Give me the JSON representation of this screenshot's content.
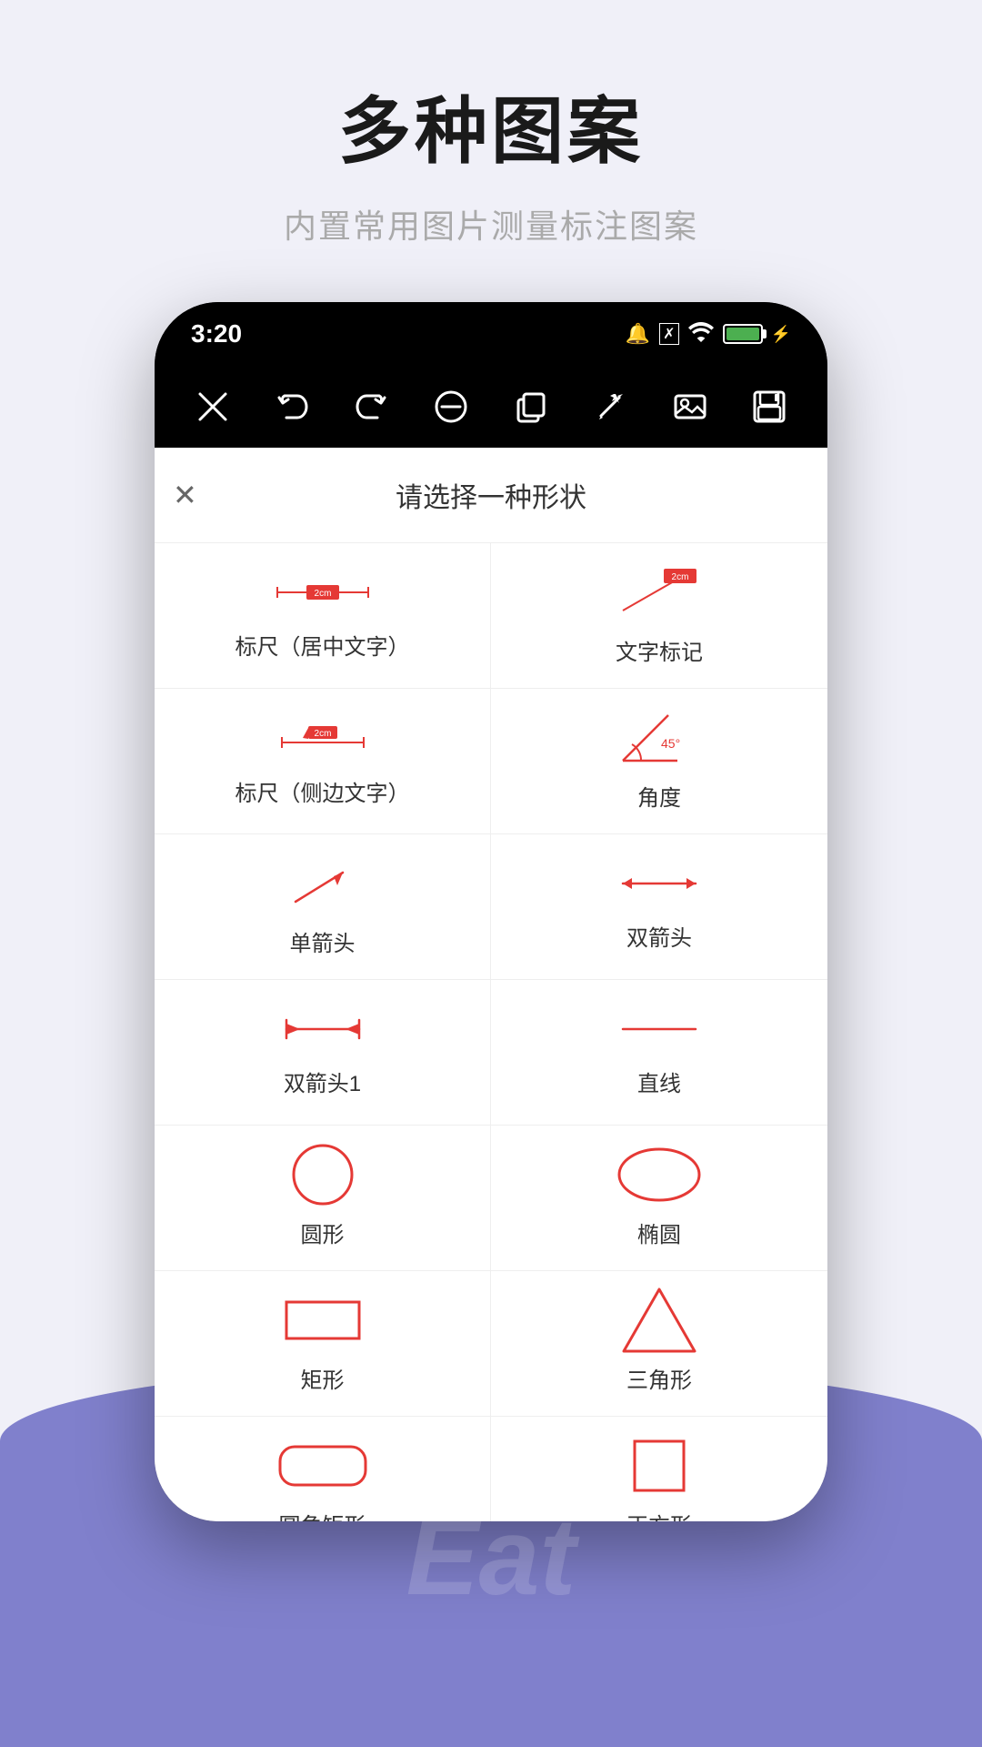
{
  "page": {
    "title": "多种图案",
    "subtitle": "内置常用图片测量标注图案",
    "background_color": "#f0f0f8",
    "accent_color": "#8080cc"
  },
  "status_bar": {
    "time": "3:20",
    "battery_percent": "100"
  },
  "toolbar": {
    "close_label": "✕",
    "undo_label": "↩",
    "redo_label": "↪",
    "minus_label": "⊖",
    "copy_label": "⧉",
    "magic_label": "⚡",
    "image_label": "🖼",
    "save_label": "💾"
  },
  "shape_picker": {
    "title": "请选择一种形状",
    "close_label": "✕",
    "shapes": [
      {
        "id": "ruler-center",
        "label": "标尺（居中文字）",
        "type": "ruler-center"
      },
      {
        "id": "text-mark",
        "label": "文字标记",
        "type": "text-mark"
      },
      {
        "id": "ruler-side",
        "label": "标尺（侧边文字）",
        "type": "ruler-side"
      },
      {
        "id": "angle",
        "label": "角度",
        "type": "angle"
      },
      {
        "id": "single-arrow",
        "label": "单箭头",
        "type": "single-arrow"
      },
      {
        "id": "double-arrow",
        "label": "双箭头",
        "type": "double-arrow"
      },
      {
        "id": "double-arrow-1",
        "label": "双箭头1",
        "type": "double-arrow-1"
      },
      {
        "id": "line",
        "label": "直线",
        "type": "line"
      },
      {
        "id": "circle",
        "label": "圆形",
        "type": "circle"
      },
      {
        "id": "ellipse",
        "label": "椭圆",
        "type": "ellipse"
      },
      {
        "id": "rectangle",
        "label": "矩形",
        "type": "rectangle"
      },
      {
        "id": "triangle",
        "label": "三角形",
        "type": "triangle"
      },
      {
        "id": "rounded-rect",
        "label": "圆角矩形",
        "type": "rounded-rect"
      },
      {
        "id": "square",
        "label": "正方形",
        "type": "square"
      }
    ]
  },
  "bottom_label": "Eat"
}
